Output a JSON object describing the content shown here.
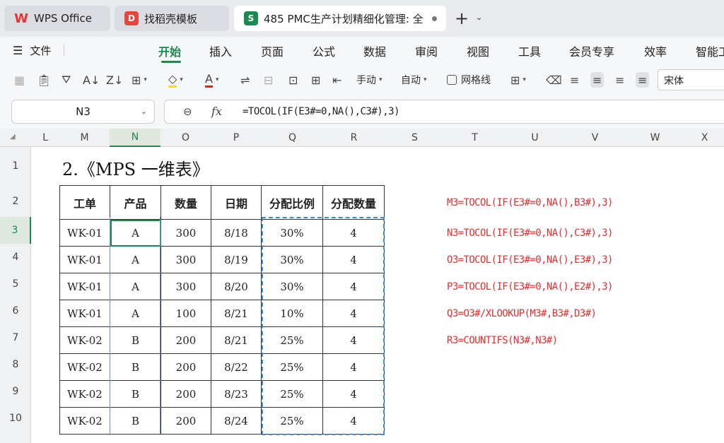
{
  "tabs": {
    "wps": "WPS Office",
    "template": "找稻壳模板",
    "document": "485 PMC生产计划精细化管理: 全",
    "new_tab": "+"
  },
  "menu": {
    "file": "文件",
    "items": [
      "开始",
      "插入",
      "页面",
      "公式",
      "数据",
      "审阅",
      "视图",
      "工具",
      "会员专享",
      "效率",
      "智能工"
    ]
  },
  "toolbar": {
    "manual": "手动",
    "auto": "自动",
    "gridlines": "网格线",
    "font_name": "宋体"
  },
  "formula_bar": {
    "name_box": "N3",
    "fx": "fx",
    "formula": "=TOCOL(IF(E3#=0,NA(),C3#),3)"
  },
  "columns": [
    "L",
    "M",
    "N",
    "O",
    "P",
    "Q",
    "R",
    "S",
    "T",
    "U",
    "V",
    "W",
    "X"
  ],
  "rows": [
    "1",
    "2",
    "3",
    "4",
    "5",
    "6",
    "7",
    "8",
    "9",
    "10"
  ],
  "sheet": {
    "title": "2.《MPS 一维表》",
    "headers": [
      "工单",
      "产品",
      "数量",
      "日期",
      "分配比例",
      "分配数量"
    ],
    "data": [
      [
        "WK-01",
        "A",
        "300",
        "8/18",
        "30%",
        "4"
      ],
      [
        "WK-01",
        "A",
        "300",
        "8/19",
        "30%",
        "4"
      ],
      [
        "WK-01",
        "A",
        "300",
        "8/20",
        "30%",
        "4"
      ],
      [
        "WK-01",
        "A",
        "100",
        "8/21",
        "10%",
        "4"
      ],
      [
        "WK-02",
        "B",
        "200",
        "8/21",
        "25%",
        "4"
      ],
      [
        "WK-02",
        "B",
        "200",
        "8/22",
        "25%",
        "4"
      ],
      [
        "WK-02",
        "B",
        "200",
        "8/23",
        "25%",
        "4"
      ],
      [
        "WK-02",
        "B",
        "200",
        "8/24",
        "25%",
        "4"
      ]
    ],
    "notes": [
      "M3=TOCOL(IF(E3#=0,NA(),B3#),3)",
      "N3=TOCOL(IF(E3#=0,NA(),C3#),3)",
      "O3=TOCOL(IF(E3#=0,NA(),E3#),3)",
      "P3=TOCOL(IF(E3#=0,NA(),E2#),3)",
      "Q3=O3#/XLOOKUP(M3#,B3#,D3#)",
      "R3=COUNTIFS(N3#,N3#)"
    ]
  }
}
